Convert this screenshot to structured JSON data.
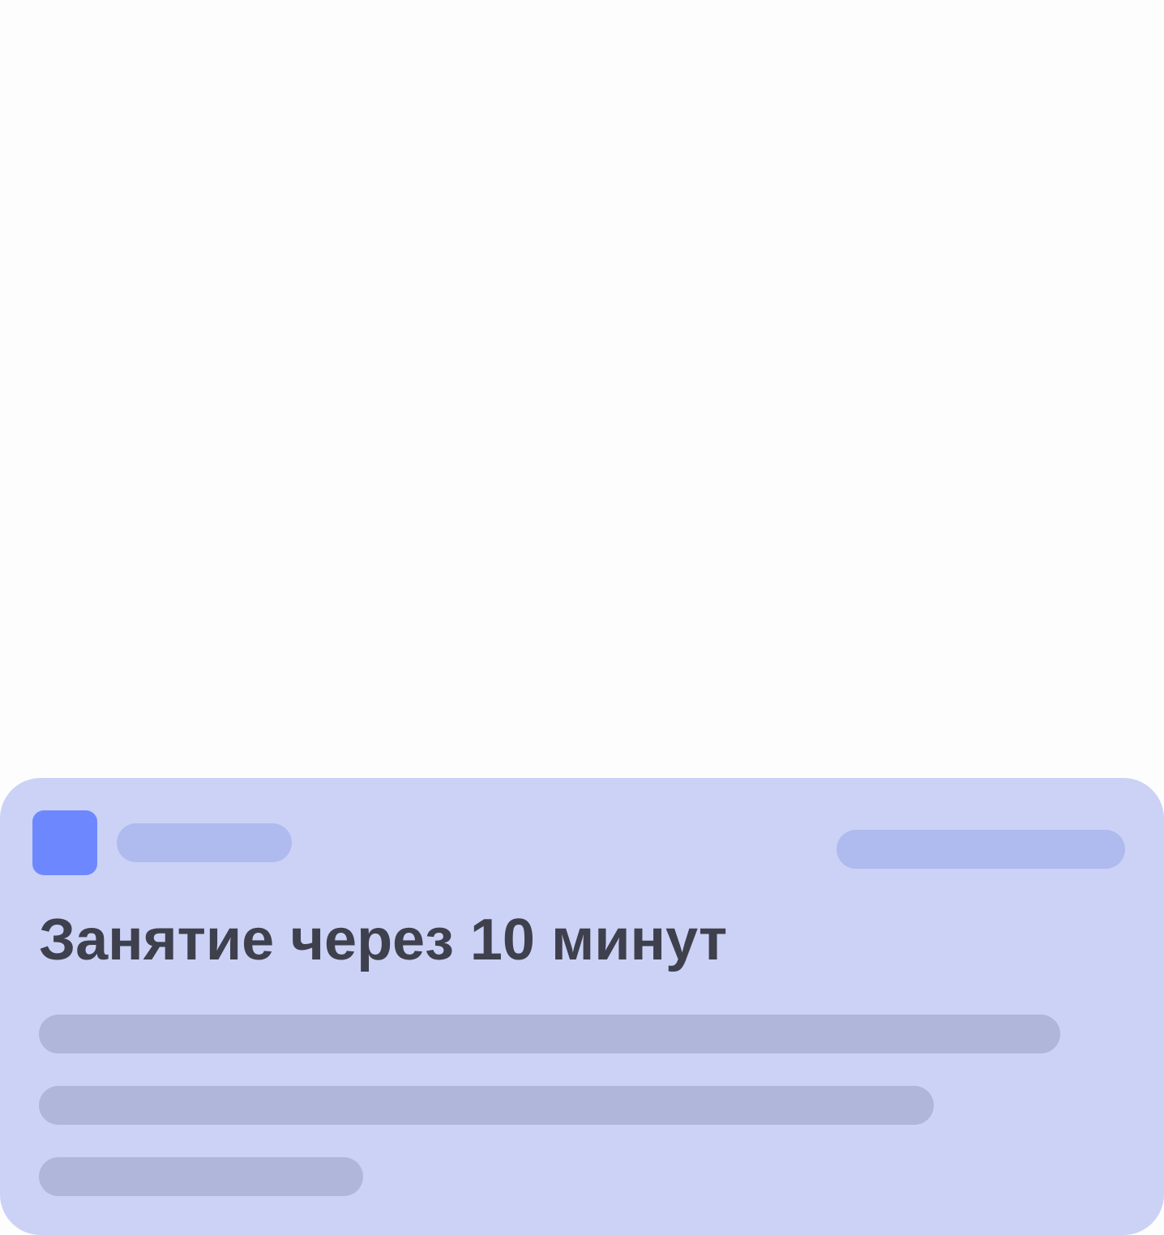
{
  "notification": {
    "title": "Занятие через 10 минут",
    "icon": "app-icon",
    "colors": {
      "card_background": "#cbd2f6",
      "app_icon": "#6d88fe",
      "title_text": "#3f404d",
      "header_placeholder": "#afbaee",
      "body_placeholder": "#afb6d9",
      "page_background": "#fdfdfd"
    }
  }
}
